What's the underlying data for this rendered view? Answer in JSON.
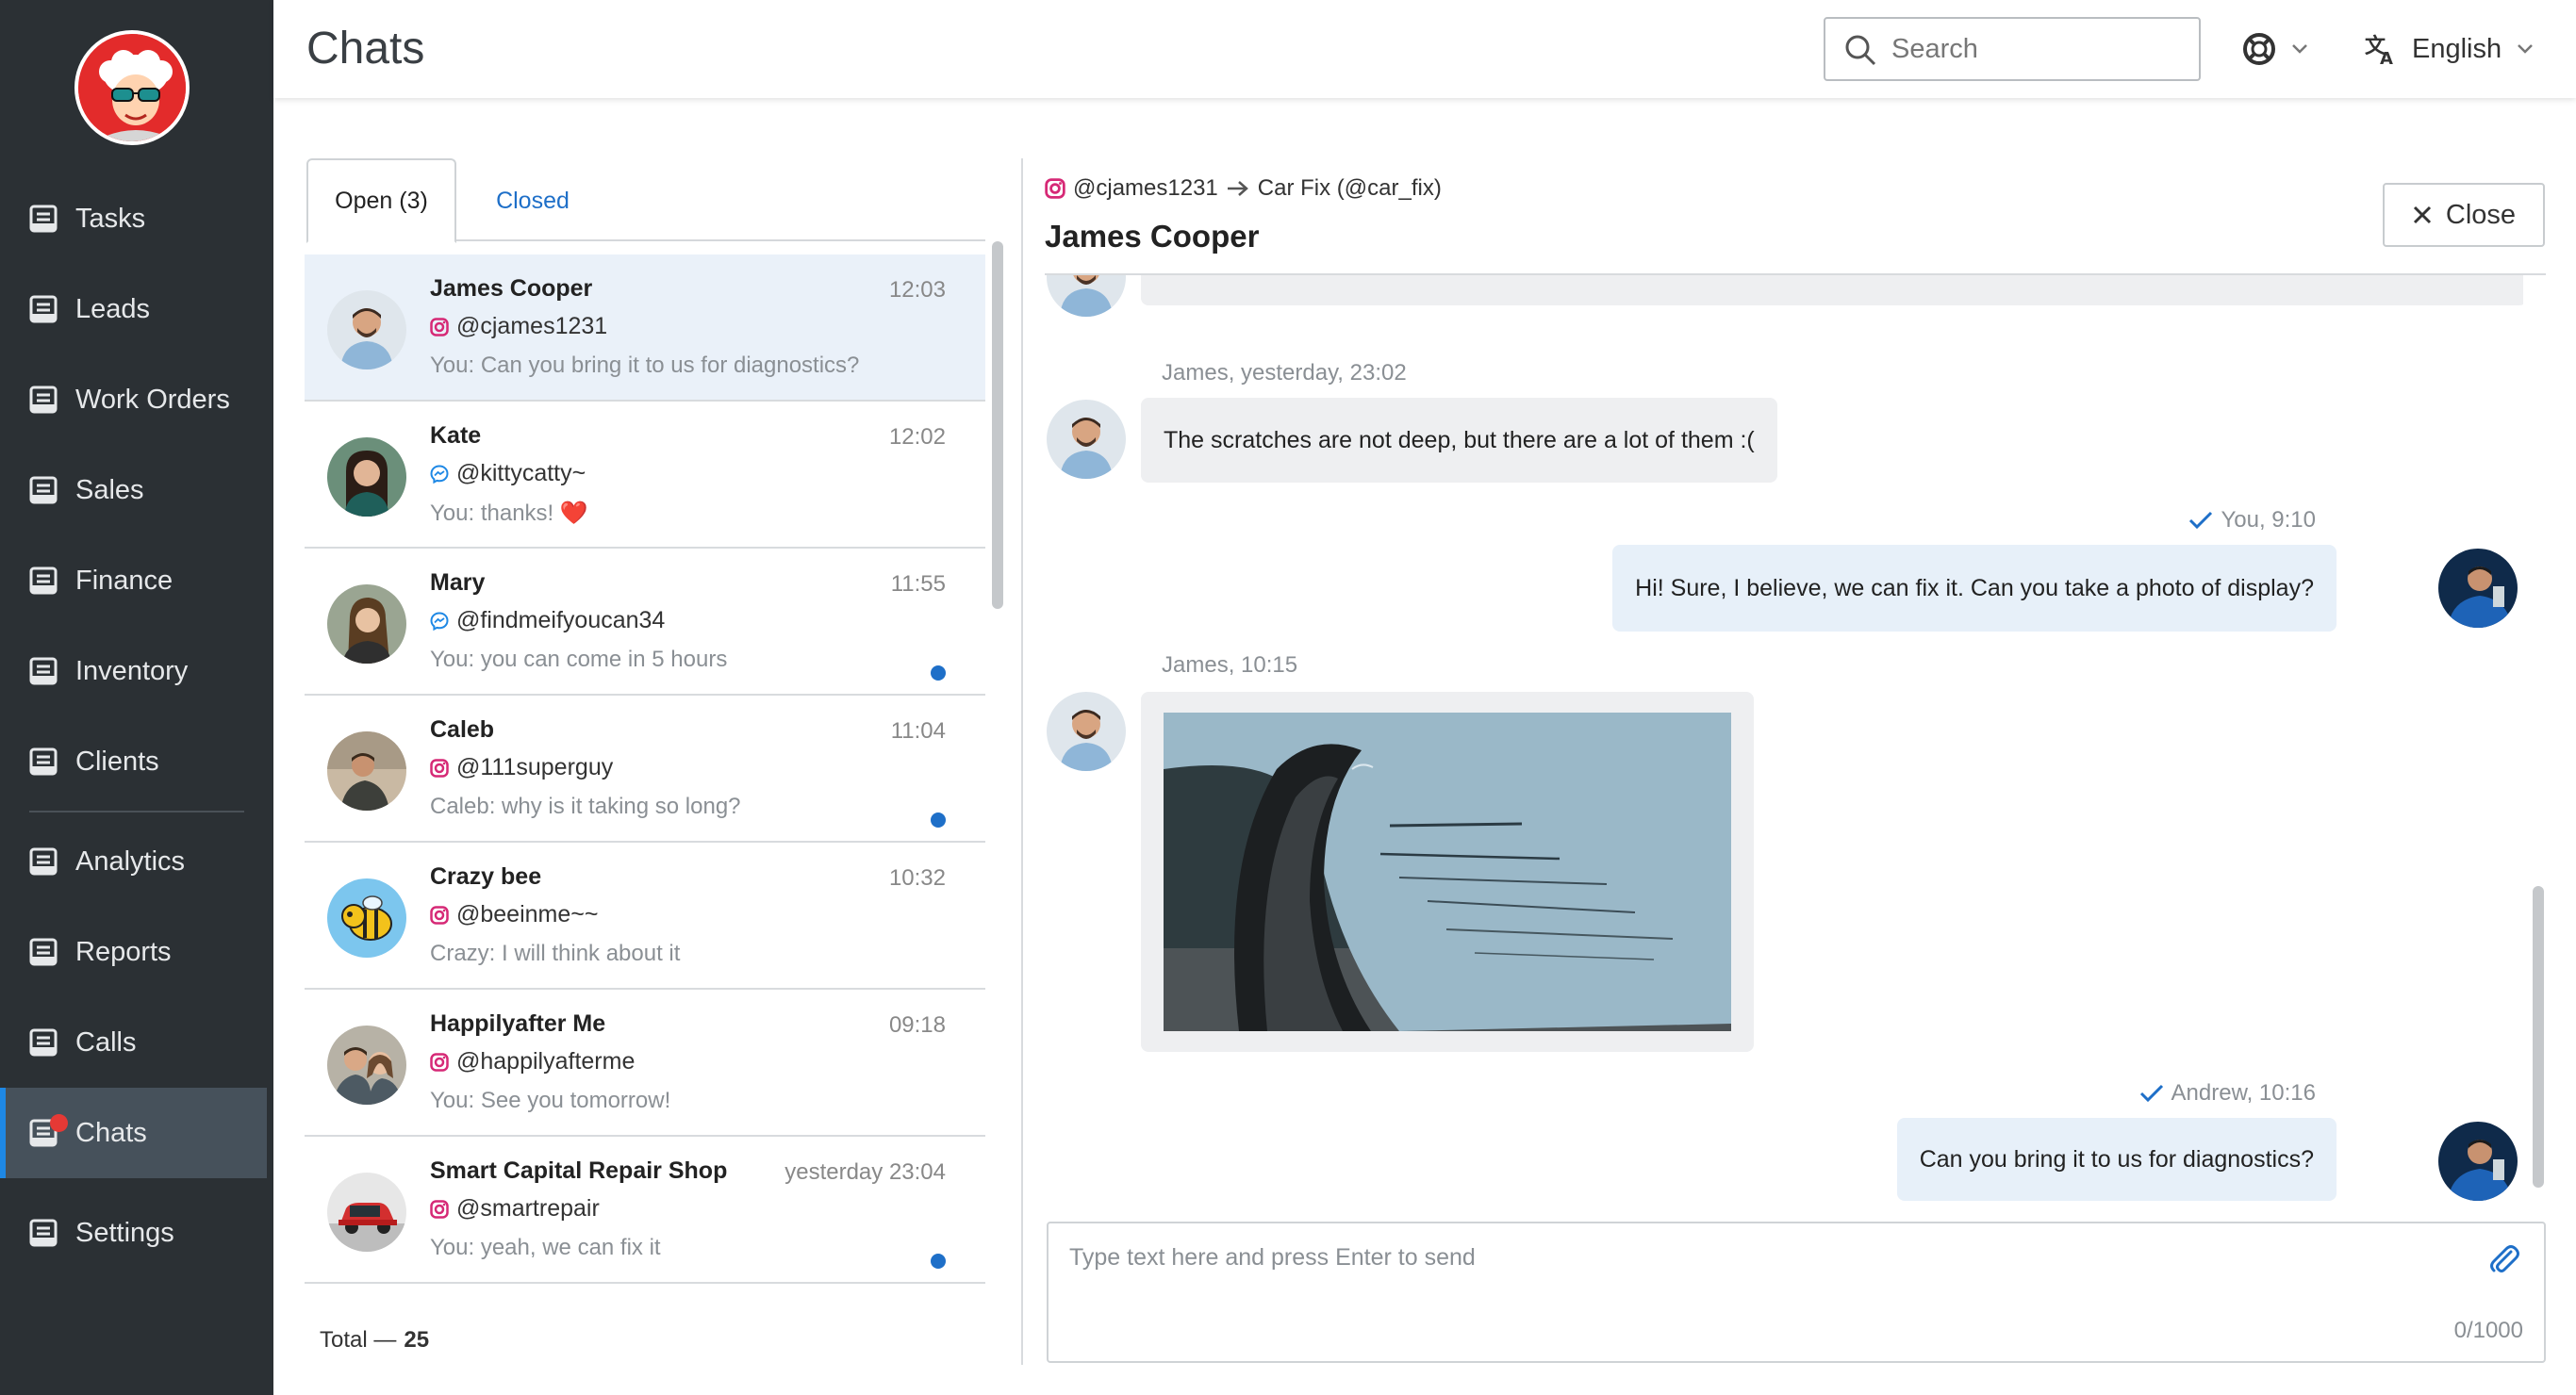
{
  "header": {
    "title": "Chats",
    "search_placeholder": "Search",
    "language": "English"
  },
  "sidebar": {
    "items": [
      {
        "label": "Tasks",
        "icon": "list-icon"
      },
      {
        "label": "Leads",
        "icon": "list-icon"
      },
      {
        "label": "Work Orders",
        "icon": "list-icon"
      },
      {
        "label": "Sales",
        "icon": "list-icon"
      },
      {
        "label": "Finance",
        "icon": "list-icon"
      },
      {
        "label": "Inventory",
        "icon": "list-icon"
      },
      {
        "label": "Clients",
        "icon": "list-icon"
      },
      {
        "label": "Analytics",
        "icon": "list-icon"
      },
      {
        "label": "Reports",
        "icon": "list-icon"
      },
      {
        "label": "Calls",
        "icon": "list-icon"
      },
      {
        "label": "Chats",
        "icon": "list-icon",
        "active": true,
        "badge": true
      },
      {
        "label": "Settings",
        "icon": "list-icon"
      }
    ]
  },
  "tabs": {
    "open": "Open (3)",
    "closed": "Closed"
  },
  "chats": [
    {
      "name": "James Cooper",
      "time": "12:03",
      "channel": "instagram",
      "handle": "@cjames1231",
      "preview": "You: Can you bring it to us for diagnostics?",
      "unread": false,
      "selected": true
    },
    {
      "name": "Kate",
      "time": "12:02",
      "channel": "messenger",
      "handle": "@kittycatty~",
      "preview": "You: thanks! ❤️",
      "unread": false
    },
    {
      "name": "Mary",
      "time": "11:55",
      "channel": "messenger",
      "handle": "@findmeifyoucan34",
      "preview": "You: you can come in 5 hours",
      "unread": true
    },
    {
      "name": "Caleb",
      "time": "11:04",
      "channel": "instagram",
      "handle": "@111superguy",
      "preview": "Caleb: why is it taking so long?",
      "unread": true
    },
    {
      "name": "Crazy bee",
      "time": "10:32",
      "channel": "instagram",
      "handle": "@beeinme~~",
      "preview": "Crazy: I will think about it",
      "unread": false
    },
    {
      "name": "Happilyafter Me",
      "time": "09:18",
      "channel": "instagram",
      "handle": "@happilyafterme",
      "preview": "You: See you tomorrow!",
      "unread": false
    },
    {
      "name": "Smart Capital Repair Shop",
      "time": "yesterday 23:04",
      "channel": "instagram",
      "handle": "@smartrepair",
      "preview": "You: yeah, we can fix it",
      "unread": true
    }
  ],
  "total": {
    "label": "Total —",
    "value": "25"
  },
  "conversation": {
    "from_handle": "@cjames1231",
    "to_account": "Car Fix (@car_fix)",
    "contact_name": "James Cooper",
    "close_label": "Close",
    "messages": [
      {
        "meta": "James, yesterday, 23:02",
        "text": "The scratches are not deep, but there are a lot of them :("
      },
      {
        "meta": "You, 9:10",
        "text": "Hi! Sure, I believe, we can fix it. Can you take a photo of display?"
      },
      {
        "meta": "James, 10:15",
        "image": "car-scratch-photo"
      },
      {
        "meta": "Andrew, 10:16",
        "text": "Can you bring it to us for diagnostics?"
      }
    ],
    "compose_placeholder": "Type text here and press Enter to send",
    "char_count": "0/1000"
  },
  "colors": {
    "sidebar_bg": "#2b3034",
    "sidebar_active": "#46515b",
    "accent": "#1e6fc8",
    "selected_row": "#eaf1f9",
    "badge": "#e53935"
  }
}
